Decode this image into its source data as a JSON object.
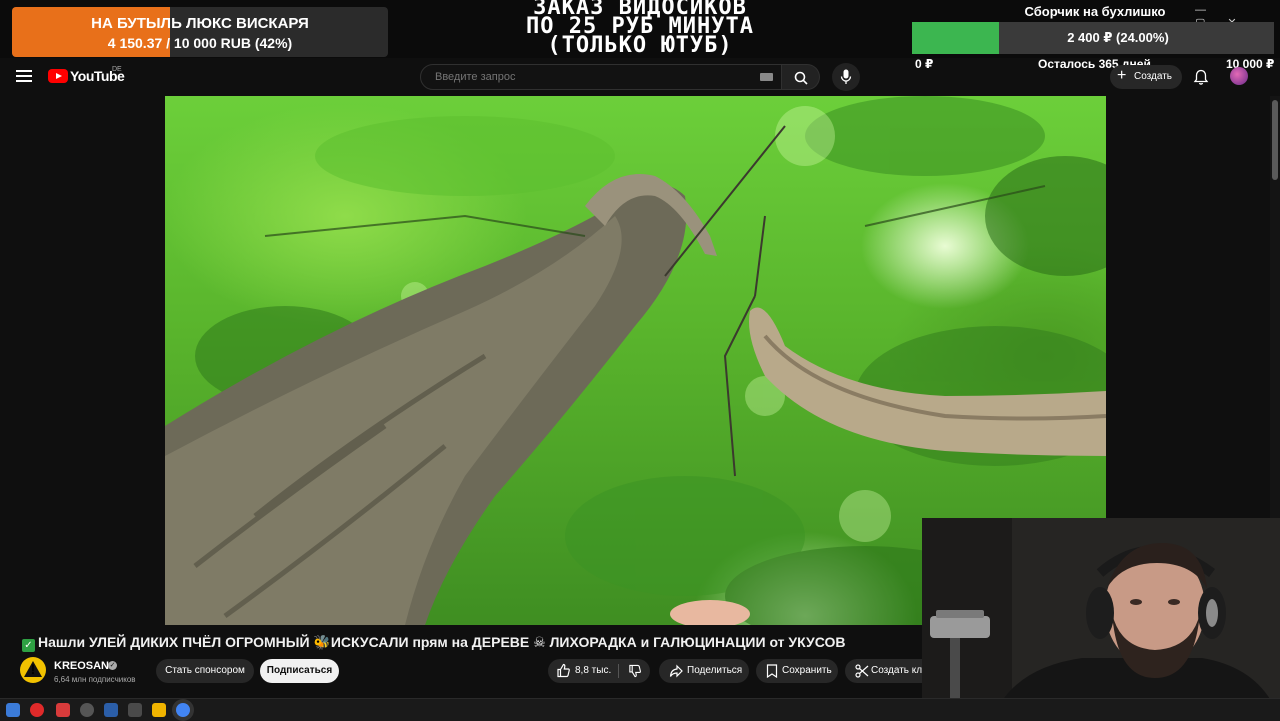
{
  "overlay": {
    "donation": {
      "title": "НА БУТЫЛЬ ЛЮКС ВИСКАРЯ",
      "amount": "4 150.37 / 10 000 RUB (42%)",
      "progress_percent": 42,
      "fill_color": "#e8701a"
    },
    "order_text": {
      "line1": "ЗАКАЗ ВИДОСИКОВ",
      "line2": "ПО 25 РУБ МИНУТА",
      "line3": "(ТОЛЬКО ЮТУБ)"
    },
    "collector": {
      "title": "Сборчик на бухлишко",
      "amount": "2 400 ₽ (24.00%)",
      "progress_percent": 24,
      "min_label": "0 ₽",
      "remaining": "Осталось 365 дней",
      "max_label": "10 000 ₽",
      "fill_color": "#3cb650"
    }
  },
  "header": {
    "logo_text": "YouTube",
    "region": "DE",
    "search_placeholder": "Введите запрос",
    "create_label": "Создать"
  },
  "video": {
    "title_parts": {
      "part1": "Нашли УЛЕЙ ДИКИХ ПЧЁЛ ОГРОМНЫЙ",
      "part2": "ИСКУСАЛИ прям на ДЕРЕВЕ",
      "part3": "ЛИХОРАДКА и ГАЛЮЦИНАЦИИ от УКУСОВ"
    },
    "emojis": {
      "check": "✓",
      "bee": "🐝",
      "skull": "☠"
    }
  },
  "channel": {
    "name": "KREOSAN",
    "subscribers": "6,64 млн подписчиков",
    "sponsor_label": "Стать спонсором",
    "subscribe_label": "Подписаться"
  },
  "actions": {
    "likes": "8,8 тыс.",
    "share_label": "Поделиться",
    "save_label": "Сохранить",
    "clip_label": "Создать кл"
  },
  "icons": {
    "menu": "menu-icon",
    "search": "search-icon",
    "mic": "mic-icon",
    "bell": "bell-icon",
    "like": "thumb-up-icon",
    "dislike": "thumb-down-icon",
    "share": "share-icon",
    "save": "bookmark-icon",
    "clip": "scissors-icon"
  }
}
